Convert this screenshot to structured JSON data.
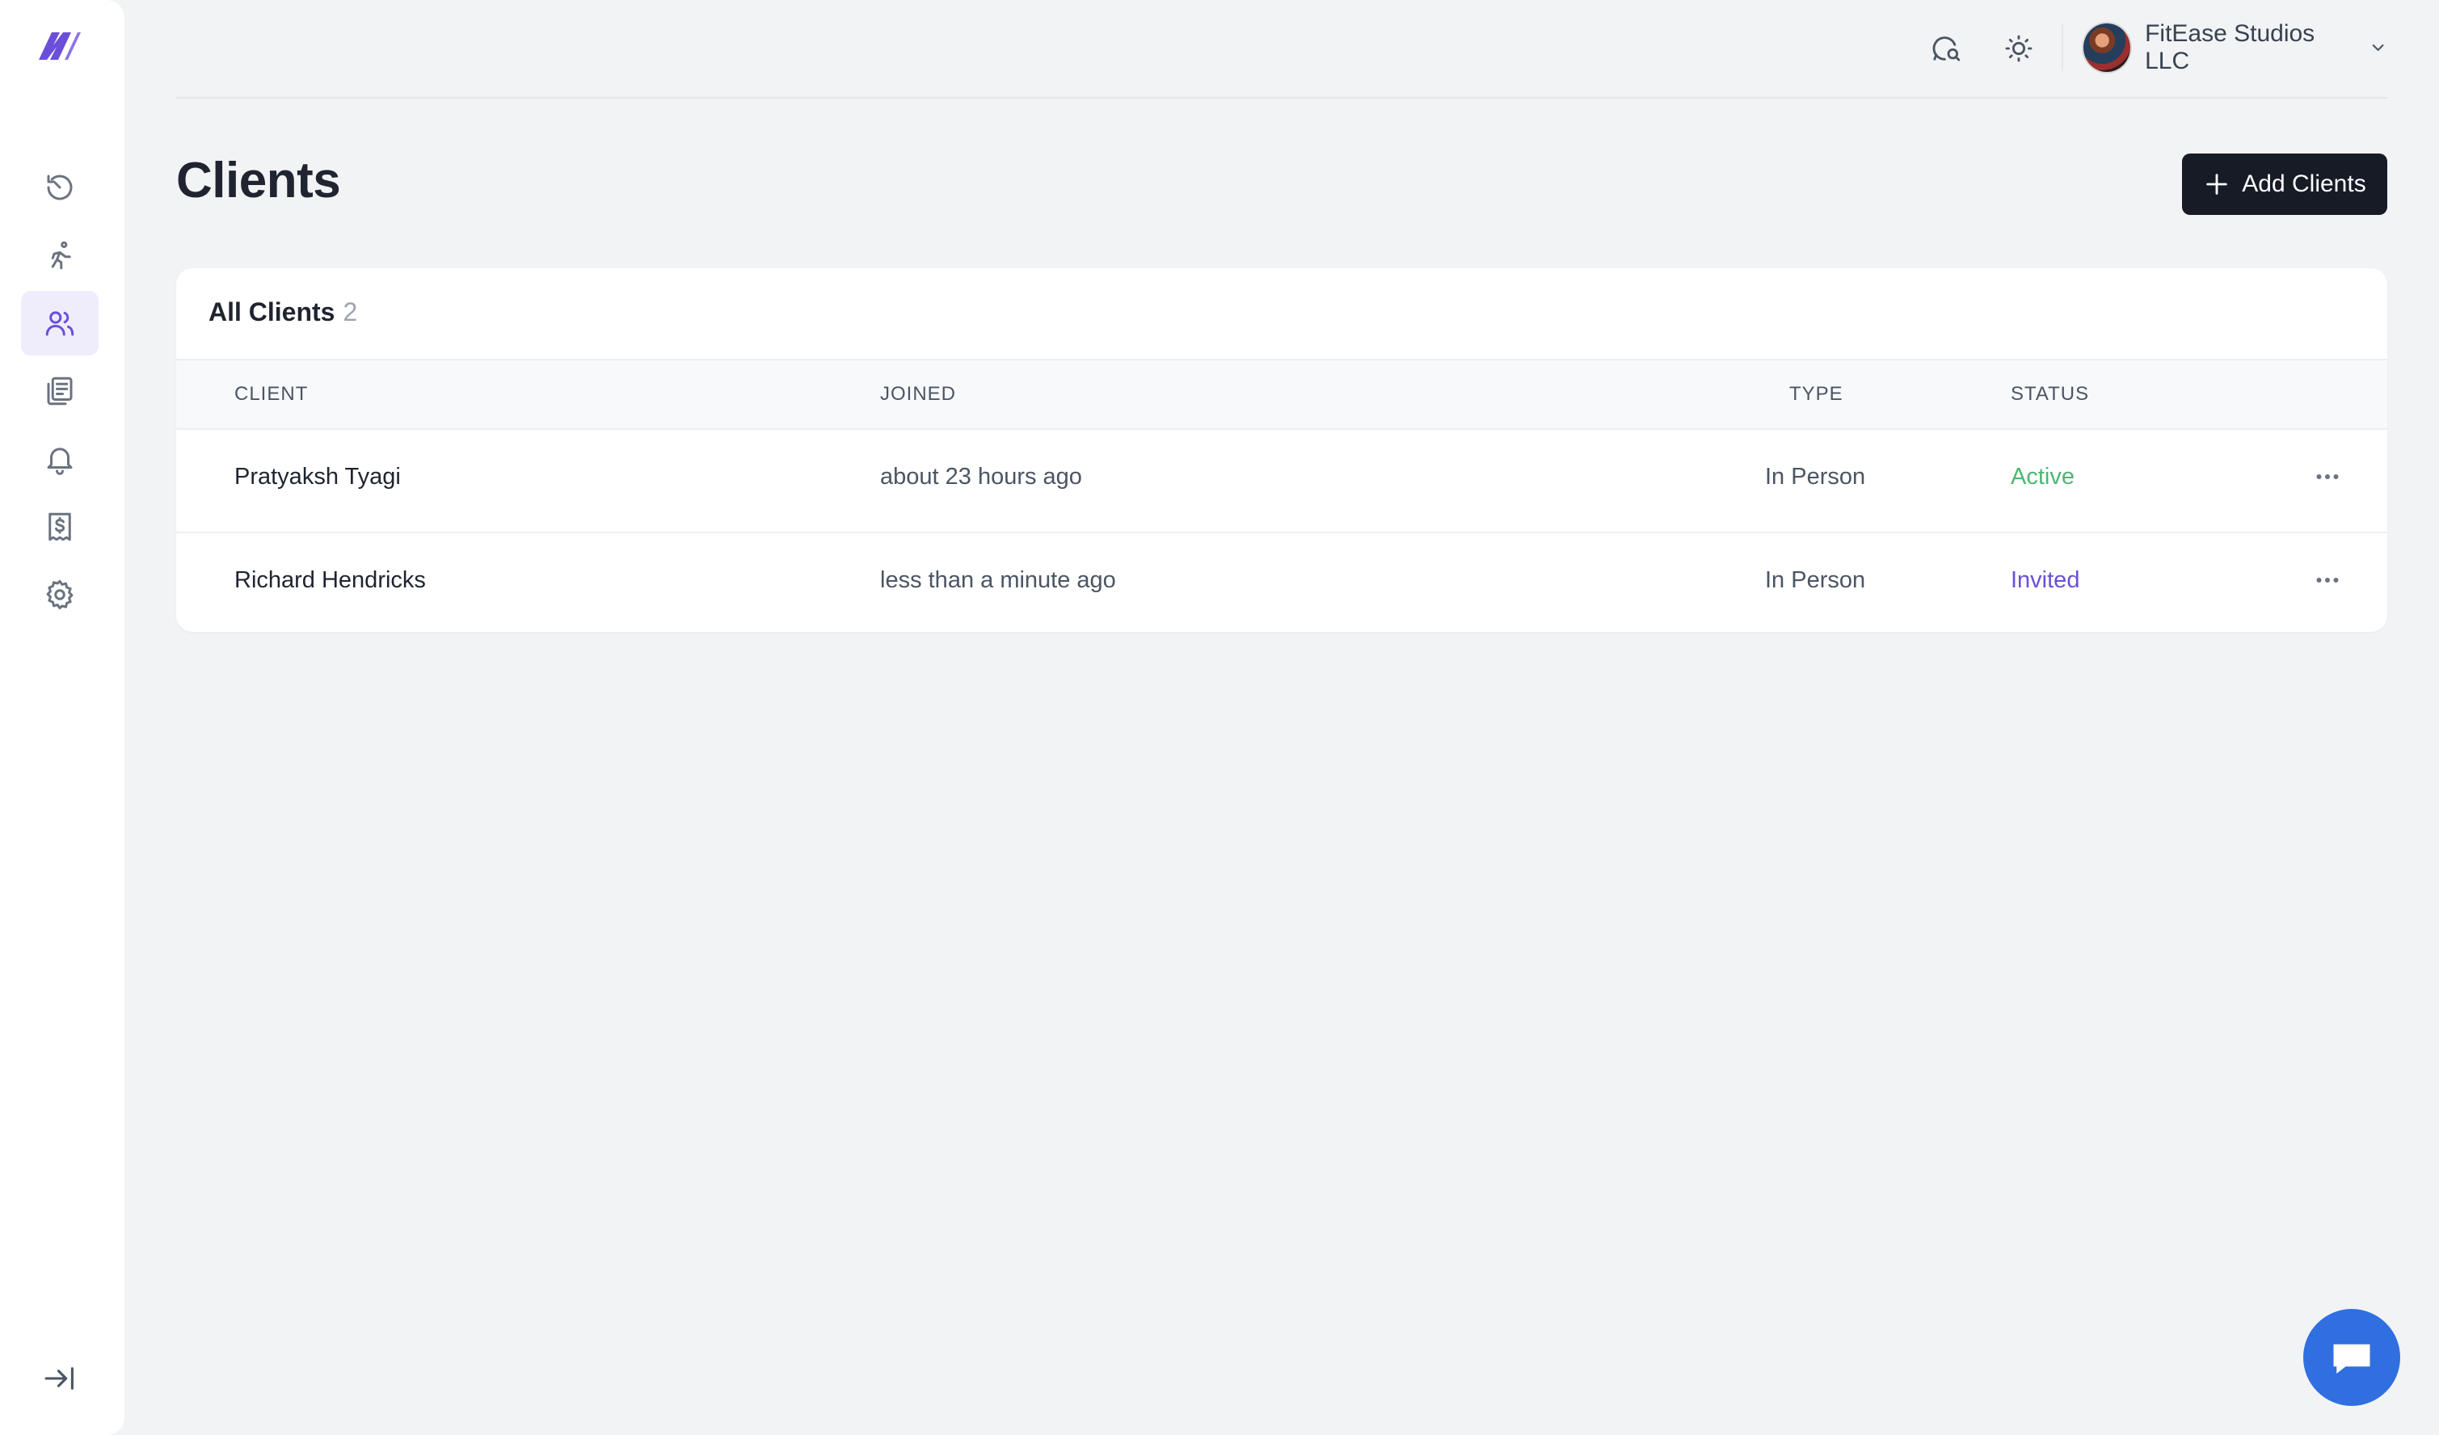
{
  "brand": {
    "accent": "#6b4fd8",
    "logo_icon": "brand-logo-icon"
  },
  "sidebar": {
    "items": [
      {
        "name": "dashboard",
        "icon": "history-icon",
        "active": false
      },
      {
        "name": "workouts",
        "icon": "runner-icon",
        "active": false
      },
      {
        "name": "clients",
        "icon": "users-icon",
        "active": true
      },
      {
        "name": "library",
        "icon": "documents-icon",
        "active": false
      },
      {
        "name": "notifications",
        "icon": "bell-icon",
        "active": false
      },
      {
        "name": "billing",
        "icon": "receipt-dollar-icon",
        "active": false
      },
      {
        "name": "settings",
        "icon": "gear-icon",
        "active": false
      }
    ],
    "collapse_icon": "collapse-sidebar-icon"
  },
  "topbar": {
    "icons": [
      "search-chat-icon",
      "sun-icon"
    ],
    "org_name": "FitEase Studios LLC"
  },
  "page": {
    "title": "Clients",
    "add_button_label": "Add Clients"
  },
  "table": {
    "title": "All Clients",
    "count": "2",
    "columns": {
      "client": "CLIENT",
      "joined": "JOINED",
      "type": "TYPE",
      "status": "STATUS"
    },
    "rows": [
      {
        "client": "Pratyaksh Tyagi",
        "joined": "about 23 hours ago",
        "type": "In Person",
        "status": "Active",
        "status_color": "#4cb872"
      },
      {
        "client": "Richard Hendricks",
        "joined": "less than a minute ago",
        "type": "In Person",
        "status": "Invited",
        "status_color": "#6b4fd8"
      }
    ]
  },
  "chat_fab": {
    "icon": "chat-bubble-icon",
    "color": "#2f6fe0"
  }
}
